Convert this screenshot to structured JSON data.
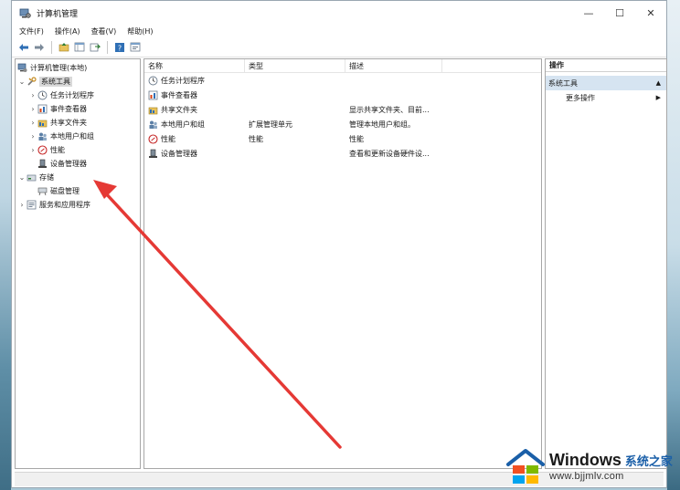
{
  "window": {
    "title": "计算机管理",
    "controls": {
      "minimize": "—",
      "maximize": "☐",
      "close": "✕"
    }
  },
  "menu": [
    "文件(F)",
    "操作(A)",
    "查看(V)",
    "帮助(H)"
  ],
  "toolbar_icons": [
    "back-arrow-icon",
    "forward-arrow-icon",
    "up-folder-icon",
    "show-hide-tree-icon",
    "export-icon",
    "help-icon",
    "properties-icon"
  ],
  "tree": {
    "root": "计算机管理(本地)",
    "system_tools": "系统工具",
    "system_children": [
      "任务计划程序",
      "事件查看器",
      "共享文件夹",
      "本地用户和组",
      "性能",
      "设备管理器"
    ],
    "storage": "存储",
    "storage_children": [
      "磁盘管理"
    ],
    "services": "服务和应用程序"
  },
  "list": {
    "columns": [
      "名称",
      "类型",
      "描述"
    ],
    "rows": [
      {
        "name": "任务计划程序",
        "type": "",
        "desc": "",
        "icon": "clock-icon"
      },
      {
        "name": "事件查看器",
        "type": "",
        "desc": "",
        "icon": "event-viewer-icon"
      },
      {
        "name": "共享文件夹",
        "type": "",
        "desc": "显示共享文件夹、目前...",
        "icon": "shared-folder-icon"
      },
      {
        "name": "本地用户和组",
        "type": "扩展管理单元",
        "desc": "管理本地用户和组。",
        "icon": "users-icon"
      },
      {
        "name": "性能",
        "type": "性能",
        "desc": "性能",
        "icon": "performance-icon"
      },
      {
        "name": "设备管理器",
        "type": "",
        "desc": "查看和更新设备硬件设...",
        "icon": "device-manager-icon"
      }
    ]
  },
  "actions": {
    "header": "操作",
    "group": "系统工具",
    "items": [
      "更多操作"
    ]
  },
  "watermark": {
    "brand": "Windows",
    "cn": "系统之家",
    "url": "www.bjjmlv.com"
  },
  "colors": {
    "selection": "#d9d9d9",
    "action_group_bg": "#d6e4f1",
    "annotation_arrow": "#e53935",
    "watermark_blue": "#1a5fa8"
  }
}
